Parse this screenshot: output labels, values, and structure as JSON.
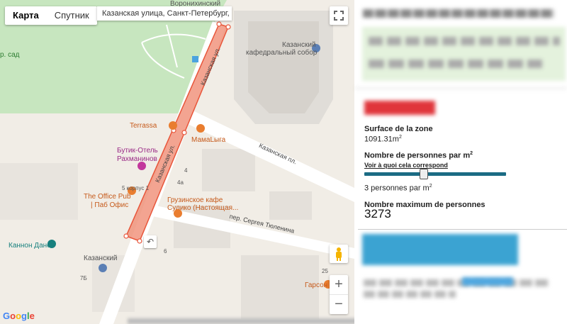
{
  "map": {
    "map_types": [
      "Карта",
      "Спутник"
    ],
    "address": "Казанская улица, Санкт-Петербург, Ро...",
    "zoom_in": "+",
    "zoom_out": "−",
    "google": [
      "G",
      "o",
      "o",
      "g",
      "l",
      "e"
    ],
    "undo_icon": "↶",
    "labels": {
      "voronikhinsky": "Воронихинский",
      "garden": "р. сад",
      "kazansky_cathedral_1": "Казанский",
      "kazansky_cathedral_2": "кафедральный собор",
      "terrassa": "Terrassa",
      "mamaliga": "МамаLыга",
      "kazanskaya_pl": "Казанская пл.",
      "kazanskaya_ul": "Казанская ул.",
      "kazanskaya_ul_top": "Казанская ул.",
      "hotel_1": "Бутик-Отель",
      "hotel_2": "Рахманинов",
      "pub_1": "The Office Pub",
      "pub_2": "| Паб Офис",
      "georgian_1": "Грузинское кафе",
      "georgian_2": "Сулико (Настоящая...",
      "tyulenina": "пер. Сергея Тюленина",
      "cannon": "Каннон Данс",
      "kazansky_bottom": "Казанский",
      "garson": "Гарсон",
      "korpus": "5 корпус 1",
      "n4": "4",
      "n4a": "4а",
      "n6": "6",
      "n25": "25",
      "n7b": "7Б"
    },
    "colors": {
      "park": "#c8e6c0",
      "land": "#f1ede6",
      "building": "#e8e4de",
      "zone": "#f08d76"
    }
  },
  "panel": {
    "surface_label": "Surface de la zone",
    "surface_value": "1091.31m",
    "surface_unit_sup": "2",
    "density_label": "Nombre de personnes par m",
    "density_sup": "2",
    "density_link": "Voir à quoi cela correspond",
    "density_value": "3 personnes par m",
    "density_value_sup": "2",
    "slider_fraction": 0.42,
    "max_label": "Nombre maximum de personnes",
    "max_value": "3273",
    "colors": {
      "red_header": "#e0353b",
      "blue_block": "#3ba3d2",
      "green_block": "#e4f2dd",
      "slider": "#1b6b84"
    }
  }
}
